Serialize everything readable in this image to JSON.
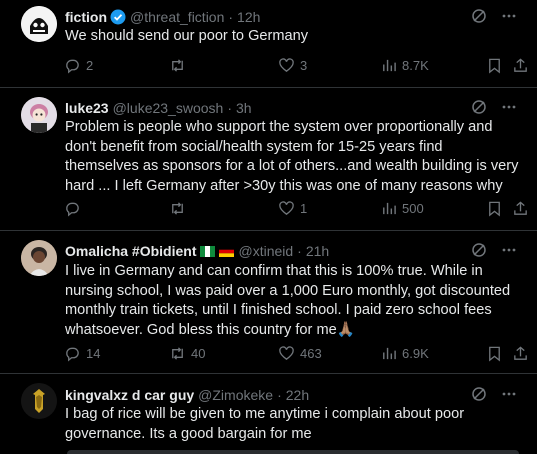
{
  "tweets": [
    {
      "name": "fiction",
      "handle": "@threat_fiction",
      "time": "12h",
      "verified": true,
      "text": "We should send our poor to Germany",
      "replies": "2",
      "retweets": "",
      "likes": "3",
      "views": "8.7K"
    },
    {
      "name": "luke23",
      "handle": "@luke23_swoosh",
      "time": "3h",
      "text": "Problem is people who support the system over proportionally and don't benefit from social/health system for 15-25 years find themselves as sponsors for a lot of others...and wealth building is very hard ... I left Germany after >30y this was one of many reasons why",
      "replies": "",
      "retweets": "",
      "likes": "1",
      "views": "500"
    },
    {
      "name": "Omalicha #Obidient",
      "handle": "@xtineid",
      "time": "21h",
      "text": "I live in Germany and can confirm that this is  100% true. While in nursing school, I was paid over a 1,000 Euro monthly, got discounted monthly train tickets, until I finished school. I paid zero school fees whatsoever. God bless this country for me🙏🏽",
      "replies": "14",
      "retweets": "40",
      "likes": "463",
      "views": "6.9K"
    },
    {
      "name": "kingvalxz d car guy",
      "handle": "@Zimokeke",
      "time": "22h",
      "text": "I bag of rice will be given to me anytime i complain about poor governance. Its a good bargain for me"
    }
  ],
  "separator": "·",
  "icons": {
    "reply": "reply-icon",
    "retweet": "retweet-icon",
    "like": "heart-icon",
    "views": "views-icon",
    "bookmark": "bookmark-icon",
    "share": "share-icon",
    "grok": "grok-icon",
    "more": "more-icon"
  },
  "colors": {
    "background": "#000000",
    "text": "#e7e9ea",
    "muted": "#71767b",
    "divider": "#2f3336",
    "verified": "#1d9bf0"
  }
}
